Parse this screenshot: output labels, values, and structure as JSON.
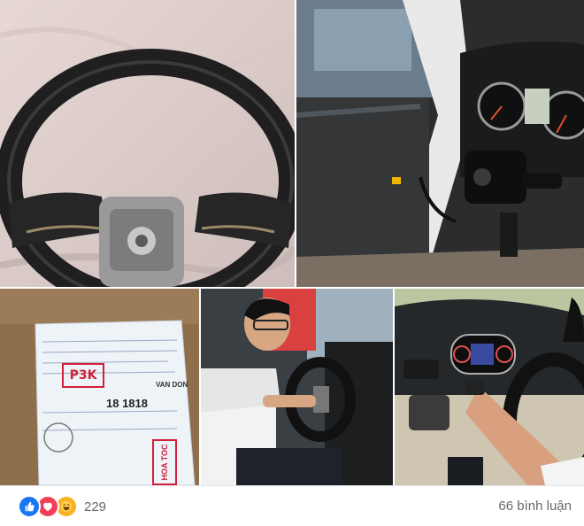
{
  "post": {
    "photos": [
      {
        "description": "steering wheel on white sheet"
      },
      {
        "description": "car interior with steering column removed"
      },
      {
        "description": "shipping waybill document"
      },
      {
        "description": "man installing steering wheel"
      },
      {
        "description": "dashboard and steering wheel installed"
      }
    ],
    "waybill": {
      "brand": "VAN DON",
      "code": "18 1818",
      "stamp": "P3K",
      "tag": "HOA TOC"
    }
  },
  "footer": {
    "reaction_count": "229",
    "comments_label": "66 bình luận",
    "reactions": [
      "like-icon",
      "love-icon",
      "haha-icon"
    ]
  },
  "colors": {
    "like": "#1877f2",
    "love": "#f33e58",
    "haha": "#f7b125",
    "meta_text": "#65676b"
  }
}
